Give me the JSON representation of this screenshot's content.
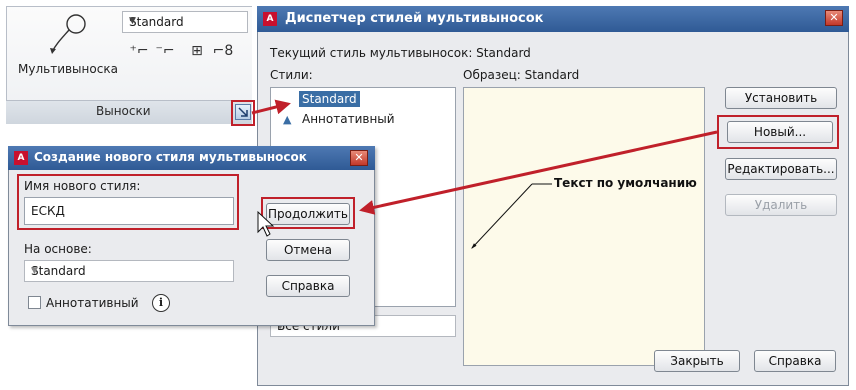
{
  "ribbon": {
    "multileader_label": "Мультивыноска",
    "style_value": "Standard",
    "panel_title": "Выноски"
  },
  "main_dialog": {
    "title": "Диспетчер стилей мультивыносок",
    "current_style_label": "Текущий стиль мультивыносок: Standard",
    "styles_label": "Стили:",
    "preview_label": "Образец: Standard",
    "styles": [
      {
        "label": "Standard",
        "selected": true,
        "annotative": false
      },
      {
        "label": "Аннотативный",
        "selected": false,
        "annotative": true
      }
    ],
    "buttons": {
      "set_current": "Установить",
      "new": "Новый...",
      "modify": "Редактировать...",
      "delete": "Удалить",
      "close": "Закрыть",
      "help": "Справка"
    },
    "filter_value": "Все стили",
    "preview_annotation": "Текст по умолчанию"
  },
  "new_dialog": {
    "title": "Создание нового стиля мультивыносок",
    "name_label": "Имя нового стиля:",
    "name_value": "ЕСКД",
    "based_on_label": "На основе:",
    "based_on_value": "Standard",
    "annotative_label": "Аннотативный",
    "annotative_checked": false,
    "buttons": {
      "continue": "Продолжить",
      "cancel": "Отмена",
      "help": "Справка"
    }
  },
  "colors": {
    "highlight": "#c0202a",
    "title_bar": "#3a67a4",
    "preview_bg": "#fdfaea"
  }
}
